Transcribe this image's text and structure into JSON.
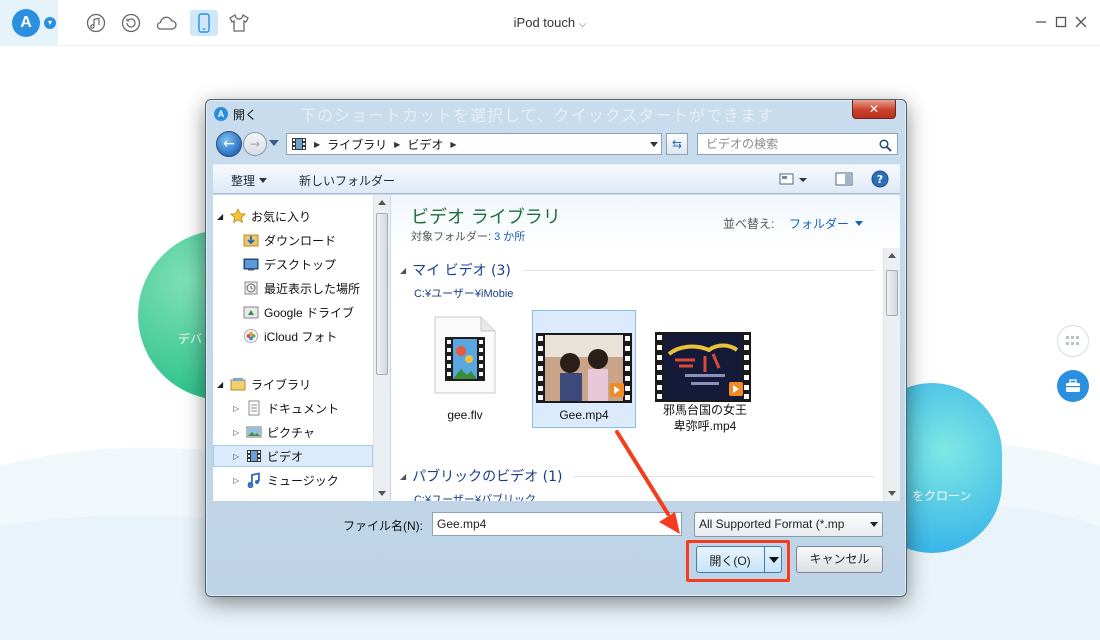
{
  "app": {
    "logo_letter": "A",
    "device_title": "iPod touch",
    "nav_icons": [
      "music-icon",
      "history-icon",
      "cloud-icon",
      "device-icon",
      "tshirt-icon"
    ],
    "window_controls": [
      "minimize-icon",
      "maximize-icon",
      "close-icon"
    ],
    "left_card_label": "デバ",
    "right_card_label": "をクローン",
    "accent": "#2b8fe0"
  },
  "dialog": {
    "title": "開く",
    "ghost_text": "下のショートカットを選択して、クイックスタートができます",
    "address": {
      "segments": [
        "ライブラリ",
        "ビデオ"
      ]
    },
    "search_placeholder": "ビデオの検索",
    "toolbar": {
      "organize": "整理",
      "new_folder": "新しいフォルダー"
    },
    "nav_tree": {
      "favorites": "お気に入り",
      "favorites_items": [
        "ダウンロード",
        "デスクトップ",
        "最近表示した場所",
        "Google ドライブ",
        "iCloud フォト"
      ],
      "libraries": "ライブラリ",
      "library_items": [
        "ドキュメント",
        "ピクチャ",
        "ビデオ",
        "ミュージック"
      ],
      "selected": "ビデオ"
    },
    "library": {
      "title": "ビデオ ライブラリ",
      "target_label": "対象フォルダー:",
      "target_count": "3 か所",
      "sort_label": "並べ替え:",
      "sort_value": "フォルダー"
    },
    "groups": [
      {
        "title": "マイ ビデオ (3)",
        "path": "C:¥ユーザー¥iMobie",
        "files": [
          {
            "name": "gee.flv"
          },
          {
            "name": "Gee.mp4"
          },
          {
            "name_line1": "邪馬台国の女王",
            "name_line2": "卑弥呼.mp4"
          }
        ]
      },
      {
        "title": "パブリックのビデオ (1)",
        "path": "C:¥ユーザー¥パブリック"
      }
    ],
    "filename_label": "ファイル名(N):",
    "filename_value": "Gee.mp4",
    "filter_value": "All Supported Format (*.mp",
    "open_button": "開く(O)",
    "cancel_button": "キャンセル"
  }
}
